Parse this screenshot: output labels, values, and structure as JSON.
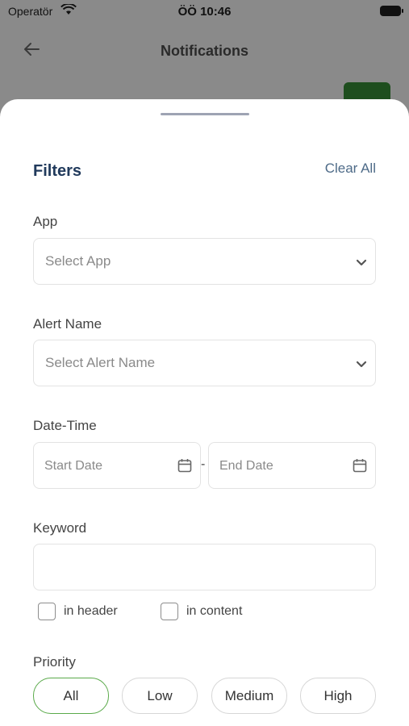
{
  "status_bar": {
    "carrier": "Operatör",
    "time": "ÖÖ 10:46"
  },
  "background": {
    "title": "Notifications"
  },
  "filters": {
    "title": "Filters",
    "clear_all": "Clear All",
    "app": {
      "label": "App",
      "placeholder": "Select App"
    },
    "alert_name": {
      "label": "Alert Name",
      "placeholder": "Select Alert Name"
    },
    "date_time": {
      "label": "Date-Time",
      "start_placeholder": "Start Date",
      "end_placeholder": "End Date",
      "separator": "-"
    },
    "keyword": {
      "label": "Keyword",
      "value": "",
      "in_header": "in header",
      "in_content": "in content"
    },
    "priority": {
      "label": "Priority",
      "options": [
        "All",
        "Low",
        "Medium",
        "High"
      ],
      "selected": "All"
    }
  },
  "colors": {
    "accent_green": "#5aaa4a",
    "title_navy": "#213a5c",
    "link_blue": "#4e6b88"
  }
}
